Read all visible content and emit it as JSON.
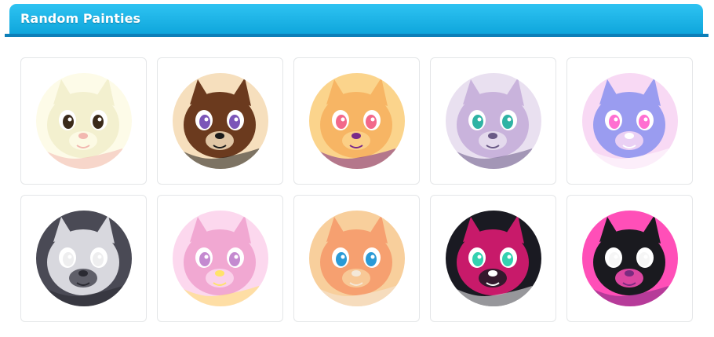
{
  "header": {
    "title": "Random Painties"
  },
  "colors": {
    "header_top": "#2ec3f2",
    "header_bottom": "#0fa6dc",
    "header_rule": "#0d7fb8",
    "card_border": "#e4e6e8"
  },
  "painties": [
    {
      "icon": "cream-dog-portrait",
      "palette": [
        "#f3f0cf",
        "#fdfbe8",
        "#3a2a1a",
        "#f2b8b0"
      ]
    },
    {
      "icon": "brown-white-cat-portrait",
      "palette": [
        "#6b3a1e",
        "#f6dfbd",
        "#7b55b8",
        "#1a1a1a"
      ]
    },
    {
      "icon": "orange-pig-portrait",
      "palette": [
        "#f7b564",
        "#fbd48c",
        "#f2688a",
        "#7a2a8a"
      ]
    },
    {
      "icon": "lavender-snow-leopard-portrait",
      "palette": [
        "#c9b3dc",
        "#e9e0f0",
        "#2fb3a4",
        "#6a5a86"
      ]
    },
    {
      "icon": "blue-pink-dragon-portrait",
      "palette": [
        "#9a9cf0",
        "#f8d9f4",
        "#ff6fd1",
        "#ffffff"
      ]
    },
    {
      "icon": "grey-ferret-portrait",
      "palette": [
        "#d8d8de",
        "#4a4a55",
        "#eeeeef",
        "#2a2a32"
      ]
    },
    {
      "icon": "pink-bunny-portrait",
      "palette": [
        "#f1a8d2",
        "#fcd8ee",
        "#c48ad0",
        "#ffe36a"
      ]
    },
    {
      "icon": "ginger-cat-portrait",
      "palette": [
        "#f6a070",
        "#f8cf9c",
        "#2a9ad6",
        "#f4e8d8"
      ]
    },
    {
      "icon": "dark-spiky-dragon-portrait",
      "palette": [
        "#c81a6a",
        "#1a1a22",
        "#33d1b0",
        "#ffffff"
      ]
    },
    {
      "icon": "black-pink-pony-portrait",
      "palette": [
        "#1a1a1f",
        "#ff4fb8",
        "#f6f6f6",
        "#7a2b80"
      ]
    }
  ]
}
